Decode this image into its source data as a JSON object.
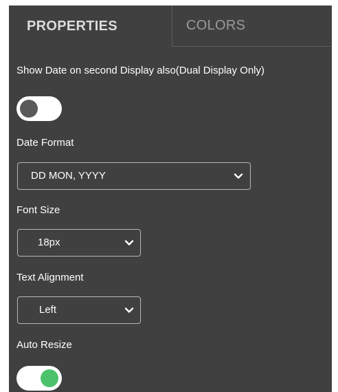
{
  "tabs": {
    "properties": "PROPERTIES",
    "colors": "COLORS"
  },
  "show_date_second_display": {
    "label": "Show Date on second Display also(Dual Display Only)",
    "enabled": false
  },
  "date_format": {
    "label": "Date Format",
    "value": "DD MON, YYYY"
  },
  "font_size": {
    "label": "Font Size",
    "value": "18px"
  },
  "text_alignment": {
    "label": "Text Alignment",
    "value": "Left"
  },
  "auto_resize": {
    "label": "Auto Resize",
    "enabled": true
  },
  "icons": {
    "select_arrow": "chevron-down-icon"
  },
  "colors": {
    "panel_bg": "#404040",
    "toggle_on": "#4cc36a",
    "toggle_off_knob": "#5a5a5a"
  }
}
